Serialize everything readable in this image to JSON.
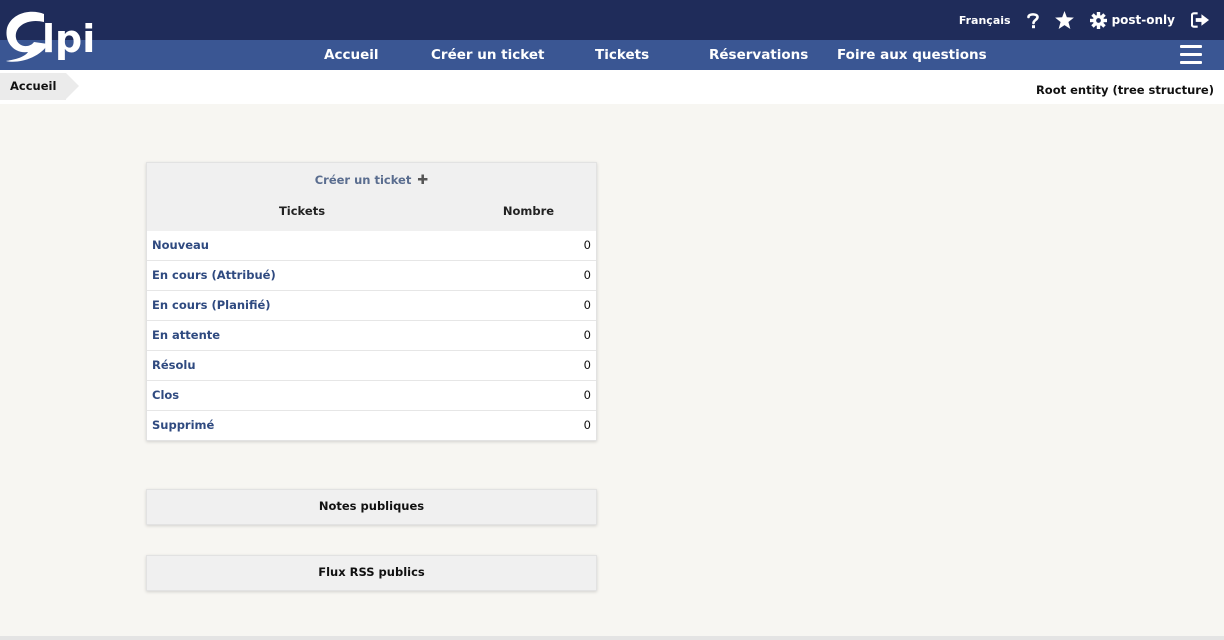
{
  "header": {
    "logo_text": "Glpi",
    "language": "Français",
    "help_icon": "question-icon",
    "favorites_icon": "star-icon",
    "settings_icon": "gear-icon",
    "user": "post-only",
    "logout_icon": "sign-out-icon"
  },
  "nav": {
    "items": [
      "Accueil",
      "Créer un ticket",
      "Tickets",
      "Réservations",
      "Foire aux questions"
    ],
    "menu_icon": "hamburger-icon"
  },
  "breadcrumb": {
    "current": "Accueil"
  },
  "entity": "Root entity (tree structure)",
  "tickets_panel": {
    "create_link": "Créer un ticket",
    "plus_icon": "plus-icon",
    "col_tickets": "Tickets",
    "col_count": "Nombre",
    "rows": [
      {
        "label": "Nouveau",
        "count": "0"
      },
      {
        "label": "En cours (Attribué)",
        "count": "0"
      },
      {
        "label": "En cours (Planifié)",
        "count": "0"
      },
      {
        "label": "En attente",
        "count": "0"
      },
      {
        "label": "Résolu",
        "count": "0"
      },
      {
        "label": "Clos",
        "count": "0"
      },
      {
        "label": "Supprimé",
        "count": "0"
      }
    ]
  },
  "notes_panel": {
    "title": "Notes publiques"
  },
  "rss_panel": {
    "title": "Flux RSS publics"
  },
  "colors": {
    "topbar": "#1f2c5a",
    "navbar": "#3a5693",
    "link": "#2f4a80",
    "background": "#f7f6f2"
  }
}
